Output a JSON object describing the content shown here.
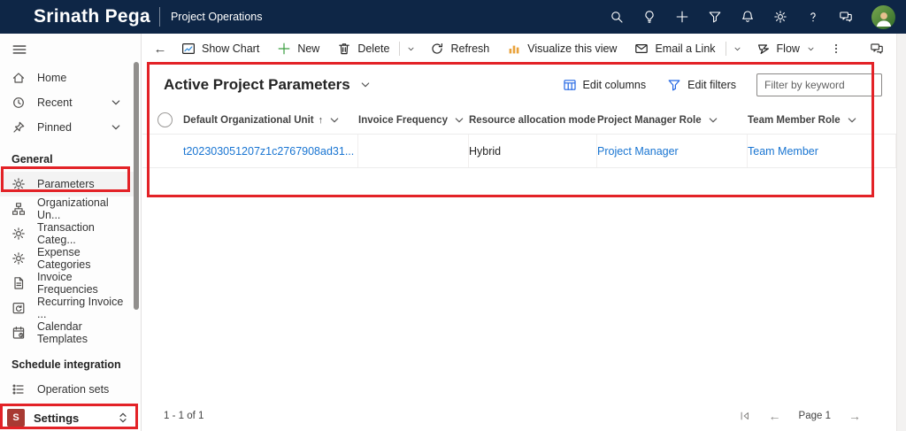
{
  "header": {
    "brand": "Srinath Pega",
    "app": "Project Operations"
  },
  "sidebar": {
    "home": "Home",
    "recent": "Recent",
    "pinned": "Pinned",
    "general_header": "General",
    "parameters": "Parameters",
    "organizational_units": "Organizational Un...",
    "transaction_categories": "Transaction Categ...",
    "expense_categories": "Expense Categories",
    "invoice_frequencies": "Invoice Frequencies",
    "recurring_invoice": "Recurring Invoice ...",
    "calendar_templates": "Calendar Templates",
    "schedule_header": "Schedule integration",
    "operation_sets": "Operation sets",
    "settings": "Settings",
    "settings_initial": "S"
  },
  "command_bar": {
    "show_chart": "Show Chart",
    "new": "New",
    "delete": "Delete",
    "refresh": "Refresh",
    "visualize": "Visualize this view",
    "email": "Email a Link",
    "flow": "Flow"
  },
  "view": {
    "title": "Active Project Parameters",
    "edit_columns": "Edit columns",
    "edit_filters": "Edit filters",
    "filter_placeholder": "Filter by keyword"
  },
  "table": {
    "columns": [
      "Default Organizational Unit",
      "Invoice Frequency",
      "Resource allocation mode",
      "Project Manager Role",
      "Team Member Role"
    ],
    "row": {
      "default_organizational_unit": "t202303051207z1c2767908ad31...",
      "invoice_frequency": "",
      "resource_allocation_mode": "Hybrid",
      "project_manager_role": "Project Manager",
      "team_member_role": "Team Member"
    }
  },
  "status": {
    "count": "1 - 1 of 1",
    "page": "Page 1"
  },
  "icons": {
    "sort_asc": "↑",
    "back_arrow": "←",
    "prev_arrow": "←",
    "next_arrow": "→"
  },
  "colors": {
    "header_bg": "#0e2646",
    "annotation_red": "#e32227",
    "link_blue": "#1975d2",
    "settings_tile": "#a83a33",
    "edit_icon_blue": "#2266e3",
    "new_plus_green": "#3a9e3f",
    "visualize_yellow": "#e9a23b",
    "chart_line_blue": "#2b88d8"
  }
}
